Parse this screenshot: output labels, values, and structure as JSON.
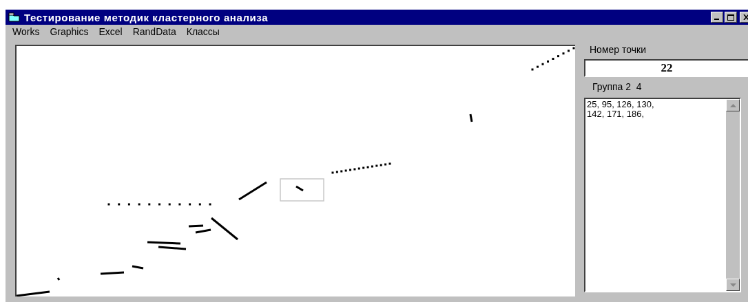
{
  "window": {
    "title": "Тестирование методик кластерного анализа",
    "controls": [
      {
        "kind": "minimize"
      },
      {
        "kind": "maximize"
      },
      {
        "kind": "close"
      }
    ]
  },
  "menu": [
    "Works",
    "Graphics",
    "Excel",
    "RandData",
    "Классы"
  ],
  "point_number": {
    "label": "Номер точки",
    "value": "22"
  },
  "group": {
    "label": "Группа 2  4"
  },
  "members": {
    "lines": [
      "25, 95, 126, 130,",
      "142, 171, 186,"
    ]
  }
}
